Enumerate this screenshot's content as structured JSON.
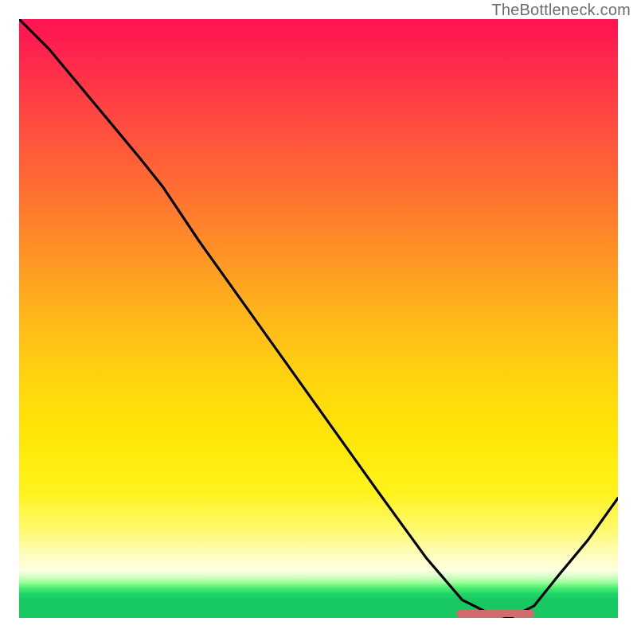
{
  "watermark": "TheBottleneck.com",
  "colors": {
    "gradient_top": "#ff1553",
    "gradient_mid_orange": "#ff9a22",
    "gradient_yellow": "#ffe707",
    "gradient_pale_yellow": "#fffcb6",
    "gradient_green": "#18c961",
    "curve_stroke": "#000000",
    "marker_fill": "#d36a6b",
    "watermark_color": "#6e6e6e"
  },
  "chart_data": {
    "type": "line",
    "x_range": [
      0,
      100
    ],
    "y_range": [
      0,
      100
    ],
    "title": "",
    "xlabel": "",
    "ylabel": "",
    "series": [
      {
        "name": "curve",
        "x": [
          0,
          5,
          10,
          15,
          20,
          24,
          30,
          40,
          50,
          60,
          68,
          74,
          78,
          82,
          86,
          90,
          95,
          100
        ],
        "y": [
          100,
          95,
          89,
          83,
          77,
          72,
          63,
          49,
          35,
          21,
          10,
          3,
          1,
          0,
          2,
          7,
          13,
          20
        ]
      }
    ],
    "marker": {
      "x_start": 73,
      "x_end": 86,
      "y": 0.8
    },
    "background_zones": [
      {
        "from_y": 0,
        "to_y": 4,
        "color": "#18c961"
      },
      {
        "from_y": 4,
        "to_y": 10,
        "color": "#fffcb6"
      },
      {
        "from_y": 10,
        "to_y": 30,
        "color": "#ffe707"
      },
      {
        "from_y": 30,
        "to_y": 70,
        "color": "#ff9a22"
      },
      {
        "from_y": 70,
        "to_y": 100,
        "color": "#ff1553"
      }
    ]
  }
}
